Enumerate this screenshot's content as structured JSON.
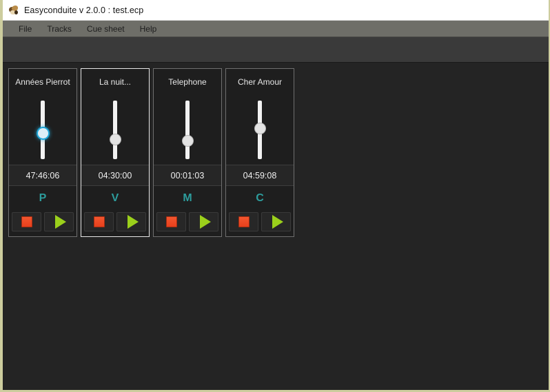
{
  "window": {
    "title": "Easyconduite v 2.0.0 : test.ecp",
    "icon": "app-mask-icon",
    "border_color": "#cdcd9e",
    "background": "#242424"
  },
  "menubar": {
    "items": [
      {
        "label": "File"
      },
      {
        "label": "Tracks"
      },
      {
        "label": "Cue sheet"
      },
      {
        "label": "Help"
      }
    ]
  },
  "toolbar": {
    "background": "#3a3a3a",
    "items": []
  },
  "tracks": [
    {
      "name": "Années Pierrot",
      "time": "47:46:06",
      "key": "P",
      "key_color": "#2d9d9d",
      "volume_percent": 52,
      "slider_focused": true,
      "selected": false,
      "stop_label": "stop-icon",
      "play_label": "play-icon"
    },
    {
      "name": "La nuit...",
      "time": "04:30:00",
      "key": "V",
      "key_color": "#2d9d9d",
      "volume_percent": 63,
      "slider_focused": false,
      "selected": true,
      "stop_label": "stop-icon",
      "play_label": "play-icon"
    },
    {
      "name": "Telephone",
      "time": "00:01:03",
      "key": "M",
      "key_color": "#2d9d9d",
      "volume_percent": 66,
      "slider_focused": false,
      "selected": false,
      "stop_label": "stop-icon",
      "play_label": "play-icon"
    },
    {
      "name": "Cher Amour",
      "time": "04:59:08",
      "key": "C",
      "key_color": "#2d9d9d",
      "volume_percent": 42,
      "slider_focused": false,
      "selected": false,
      "stop_label": "stop-icon",
      "play_label": "play-icon"
    }
  ]
}
